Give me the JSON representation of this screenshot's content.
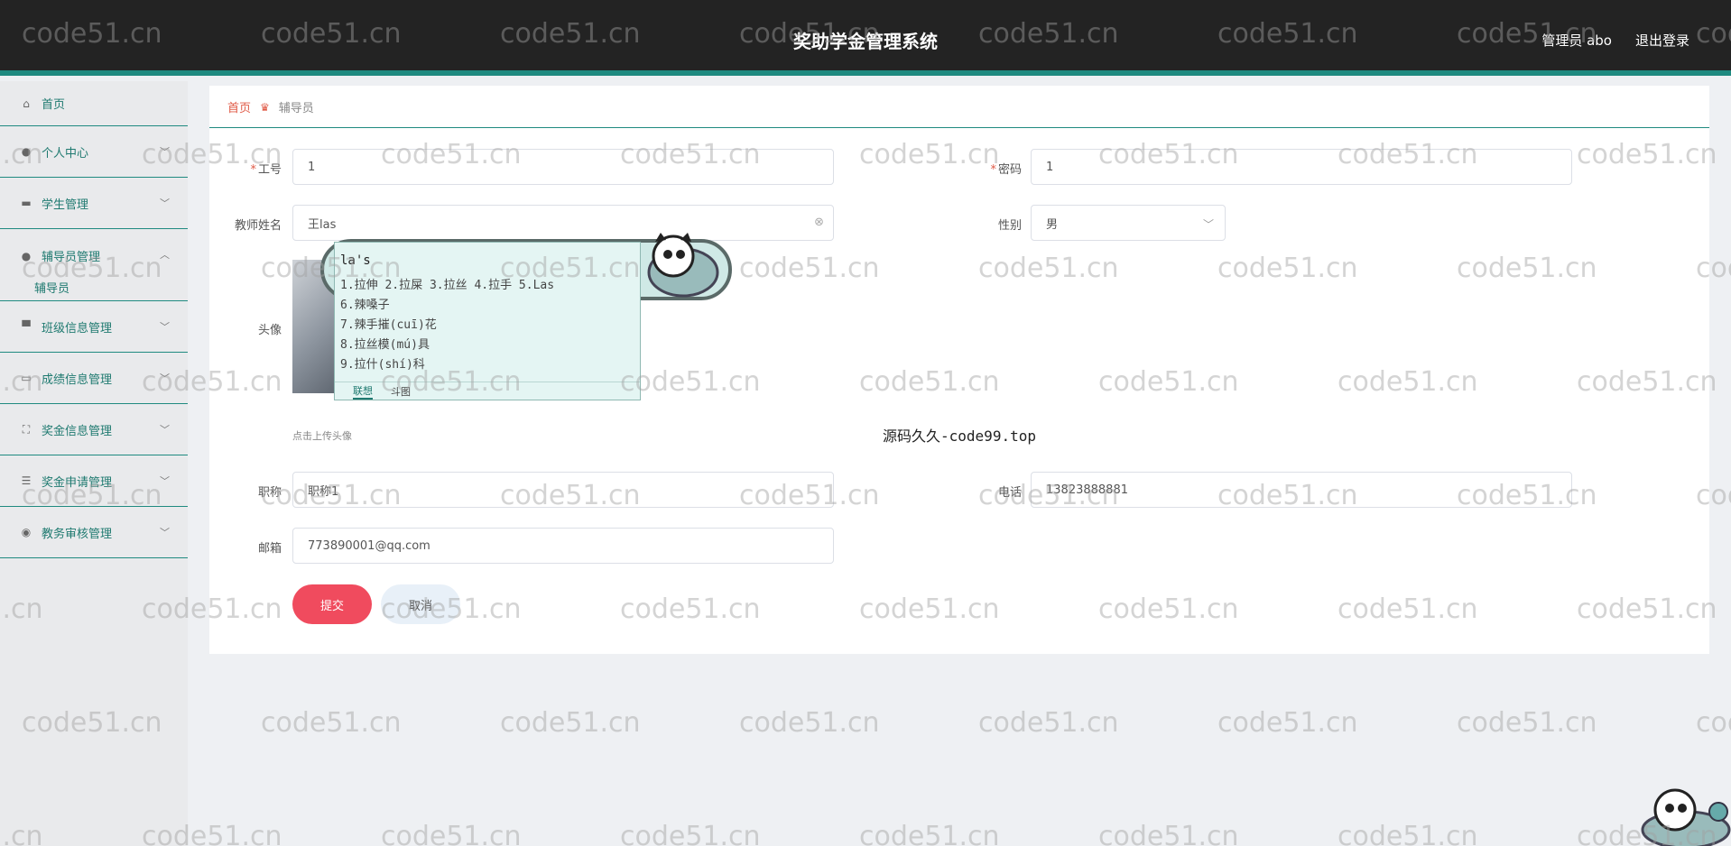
{
  "header": {
    "title": "奖助学金管理系统",
    "user": "管理员 abo",
    "logout": "退出登录"
  },
  "sidebar": {
    "items": [
      {
        "label": "首页",
        "icon": "home-icon"
      },
      {
        "label": "个人中心",
        "icon": "user-icon"
      },
      {
        "label": "学生管理",
        "icon": "briefcase-icon"
      },
      {
        "label": "辅导员管理",
        "icon": "user-icon",
        "open": true,
        "sub": "辅导员"
      },
      {
        "label": "班级信息管理",
        "icon": "flag-icon"
      },
      {
        "label": "成绩信息管理",
        "icon": "card-icon"
      },
      {
        "label": "奖金信息管理",
        "icon": "scan-icon"
      },
      {
        "label": "奖金申请管理",
        "icon": "list-icon"
      },
      {
        "label": "教务审核管理",
        "icon": "badge-icon"
      }
    ]
  },
  "breadcrumb": {
    "home": "首页",
    "current": "辅导员"
  },
  "form": {
    "work_no_label": "工号",
    "work_no_value": "1",
    "password_label": "密码",
    "password_value": "1",
    "name_label": "教师姓名",
    "name_value": "王las",
    "gender_label": "性别",
    "gender_value": "男",
    "avatar_label": "头像",
    "avatar_hint": "点击上传头像",
    "title_label": "职称",
    "title_value": "职称1",
    "phone_label": "电话",
    "phone_value": "13823888881",
    "email_label": "邮箱",
    "email_value": "773890001@qq.com",
    "submit": "提交",
    "cancel": "取消"
  },
  "note": "源码久久-code99.top",
  "ime": {
    "composition": "la's",
    "candidates_row1": "1.拉伸  2.拉屎  3.拉丝  4.拉手  5.Las",
    "c6": "6.辣嗓子",
    "c7": "7.辣手摧(cuī)花",
    "c8": "8.拉丝模(mú)具",
    "c9": "9.拉什(shí)科",
    "tab1": "联想",
    "tab2": "斗图"
  },
  "watermark": "code51.cn"
}
